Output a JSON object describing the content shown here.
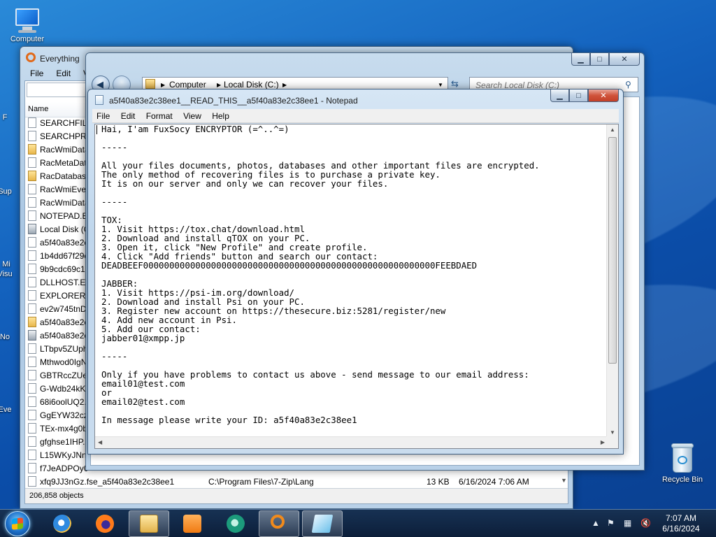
{
  "desktop": {
    "icons": {
      "computer": "Computer",
      "recycle_bin": "Recycle Bin"
    },
    "partial_labels": [
      "F",
      "Sup",
      "Mi",
      "Visu",
      "No",
      "Eve"
    ]
  },
  "everything": {
    "title": "Everything",
    "menu": [
      "File",
      "Edit",
      "Vie"
    ],
    "column_name": "Name",
    "rows": [
      "SEARCHFILT",
      "SEARCHPRO",
      "RacWmiData",
      "RacMetaData",
      "RacDatabase",
      "RacWmiEven",
      "RacWmiData",
      "NOTEPAD.EX",
      "Local Disk (C",
      "a5f40a83e2c",
      "1b4dd67f29c",
      "9b9cdc69c1c",
      "DLLHOST.EX",
      "EXPLORER.EX",
      "ev2w745tnD.",
      "a5f40a83e2c",
      "a5f40a83e2c",
      "LTbpv5ZUph",
      "Mthwod0IgN",
      "GBTRccZUe4",
      "G-Wdb24kKr",
      "68i6oolUQ2.",
      "GgEYW32czi",
      "TEx-mx4g0b",
      "gfghse1IHP.",
      "L15WKyJNnT",
      "f7JeADPOy0",
      "xfq9JJ3nGz.fse_a5f40a83e2c38ee1"
    ],
    "last_row": {
      "path": "C:\\Program Files\\7-Zip\\Lang",
      "size": "13 KB",
      "date": "6/16/2024 7:06 AM"
    },
    "status": "206,858 objects"
  },
  "explorer": {
    "breadcrumb": [
      "Computer",
      "Local Disk (C:)"
    ],
    "search_placeholder": "Search Local Disk (C:)"
  },
  "notepad": {
    "title": "a5f40a83e2c38ee1__READ_THIS__a5f40a83e2c38ee1 - Notepad",
    "menu": [
      "File",
      "Edit",
      "Format",
      "View",
      "Help"
    ],
    "text": "Hai, I'am FuxSocy ENCRYPTOR (=^..^=)\n\n-----\n\nAll your files documents, photos, databases and other important files are encrypted.\nThe only method of recovering files is to purchase a private key.\nIt is on our server and only we can recover your files.\n\n-----\n\nTOX:\n1. Visit https://tox.chat/download.html\n2. Download and install qTOX on your PC.\n3. Open it, click \"New Profile\" and create profile.\n4. Click \"Add friends\" button and search our contact:\nDEADBEEF00000000000000000000000000000000000000000000000000000000FEEBDAED\n\nJABBER:\n1. Visit https://psi-im.org/download/\n2. Download and install Psi on your PC.\n3. Register new account on https://thesecure.biz:5281/register/new\n4. Add new account in Psi.\n5. Add our contact:\njabber01@xmpp.jp\n\n-----\n\nOnly if you have problems to contact us above - send message to our email address:\nemail01@test.com\nor\nemail02@test.com\n\nIn message please write your ID: a5f40a83e2c38ee1"
  },
  "taskbar": {
    "items": [
      "start",
      "internet-explorer",
      "firefox",
      "file-explorer",
      "media-player",
      "network-tool",
      "everything-search",
      "notepad"
    ],
    "clock_time": "7:07 AM",
    "clock_date": "6/16/2024"
  }
}
